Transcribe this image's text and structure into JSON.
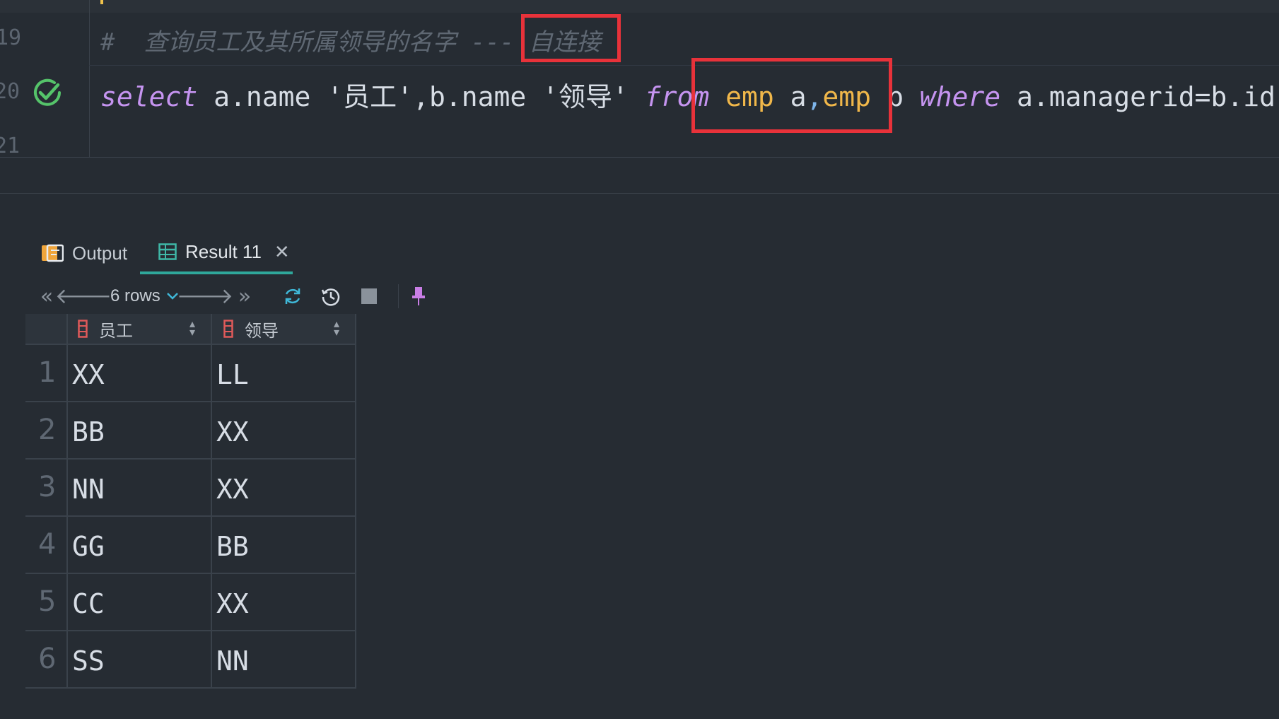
{
  "editor": {
    "line_numbers": [
      "19",
      "20",
      "21"
    ],
    "comment": {
      "prefix": "#  查询员工及其所属领导的名字 --- ",
      "highlight": "自连接"
    },
    "sql": {
      "select": "select",
      "part1": " a.name '员工',b.name '领导' ",
      "from": "from",
      "space": " ",
      "emp1": "emp",
      "alias1": " a",
      "comma": ",",
      "emp2": "emp",
      "alias2": " b",
      "where": "where",
      "condition": " a.managerid=b.id",
      "semicolon": ";"
    },
    "status_icon": "check-circle-icon",
    "highlight_color": "#e8323a"
  },
  "panel": {
    "tabs": [
      {
        "label": "Output",
        "icon": "output-console-icon"
      },
      {
        "label": "Result 11",
        "icon": "table-grid-icon",
        "closable": true
      }
    ],
    "active_tab": "Result 11",
    "toolbar": {
      "rows_label": "6 rows",
      "icons": [
        "first-page-icon",
        "prev-page-icon",
        "chevron-down-icon",
        "next-page-icon",
        "last-page-icon",
        "refresh-icon",
        "history-icon",
        "stop-icon",
        "pin-icon"
      ]
    },
    "accent_color": "#2fa89b"
  },
  "grid": {
    "columns": [
      "员工",
      "领导"
    ],
    "rows": [
      {
        "n": "1",
        "c1": "XX",
        "c2": "LL"
      },
      {
        "n": "2",
        "c1": "BB",
        "c2": "XX"
      },
      {
        "n": "3",
        "c1": "NN",
        "c2": "XX"
      },
      {
        "n": "4",
        "c1": "GG",
        "c2": "BB"
      },
      {
        "n": "5",
        "c1": "CC",
        "c2": "XX"
      },
      {
        "n": "6",
        "c1": "SS",
        "c2": "NN"
      }
    ]
  }
}
